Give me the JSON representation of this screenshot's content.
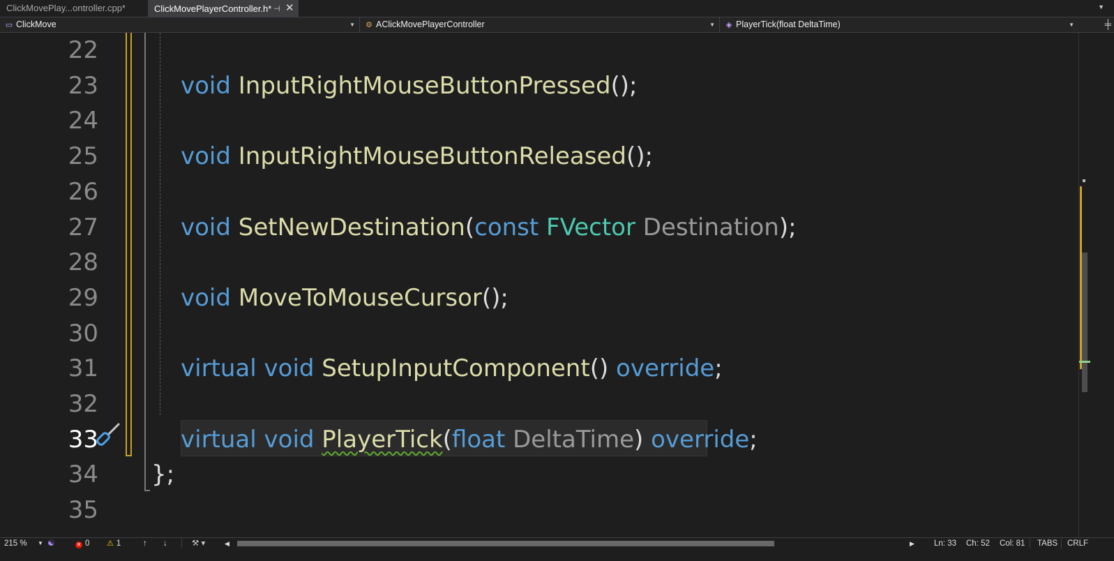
{
  "tabs": [
    {
      "label": "ClickMovePlay...ontroller.cpp*",
      "active": false
    },
    {
      "label": "ClickMovePlayerController.h*",
      "active": true,
      "pin_icon": "pin-icon",
      "close_icon": "close-icon"
    }
  ],
  "navbar": {
    "project": "ClickMove",
    "class_scope": "AClickMovePlayerController",
    "member": "PlayerTick(float DeltaTime)"
  },
  "editor": {
    "current_line": 33,
    "lines": [
      {
        "number": "22",
        "tokens": []
      },
      {
        "number": "23",
        "tokens": [
          {
            "t": "void",
            "c": "kw"
          },
          {
            "t": " "
          },
          {
            "t": "InputRightMouseButtonPressed",
            "c": "fn"
          },
          {
            "t": "();",
            "c": "pn"
          }
        ]
      },
      {
        "number": "24",
        "tokens": []
      },
      {
        "number": "25",
        "tokens": [
          {
            "t": "void",
            "c": "kw"
          },
          {
            "t": " "
          },
          {
            "t": "InputRightMouseButtonReleased",
            "c": "fn"
          },
          {
            "t": "();",
            "c": "pn"
          }
        ]
      },
      {
        "number": "26",
        "tokens": []
      },
      {
        "number": "27",
        "tokens": [
          {
            "t": "void",
            "c": "kw"
          },
          {
            "t": " "
          },
          {
            "t": "SetNewDestination",
            "c": "fn"
          },
          {
            "t": "(",
            "c": "pn"
          },
          {
            "t": "const",
            "c": "kw"
          },
          {
            "t": " "
          },
          {
            "t": "FVector",
            "c": "tp"
          },
          {
            "t": " "
          },
          {
            "t": "Destination",
            "c": "pm"
          },
          {
            "t": ");",
            "c": "pn"
          }
        ]
      },
      {
        "number": "28",
        "tokens": []
      },
      {
        "number": "29",
        "tokens": [
          {
            "t": "void",
            "c": "kw"
          },
          {
            "t": " "
          },
          {
            "t": "MoveToMouseCursor",
            "c": "fn"
          },
          {
            "t": "();",
            "c": "pn"
          }
        ]
      },
      {
        "number": "30",
        "tokens": []
      },
      {
        "number": "31",
        "tokens": [
          {
            "t": "virtual",
            "c": "kw"
          },
          {
            "t": " "
          },
          {
            "t": "void",
            "c": "kw"
          },
          {
            "t": " "
          },
          {
            "t": "SetupInputComponent",
            "c": "fn"
          },
          {
            "t": "() ",
            "c": "pn"
          },
          {
            "t": "override",
            "c": "kw"
          },
          {
            "t": ";",
            "c": "pn"
          }
        ]
      },
      {
        "number": "32",
        "tokens": []
      },
      {
        "number": "33",
        "tokens": [
          {
            "t": "virtual",
            "c": "kw"
          },
          {
            "t": " "
          },
          {
            "t": "void",
            "c": "kw"
          },
          {
            "t": " "
          },
          {
            "t": "PlayerTick",
            "c": "fn",
            "squiggle": true
          },
          {
            "t": "(",
            "c": "pn"
          },
          {
            "t": "float",
            "c": "kw"
          },
          {
            "t": " "
          },
          {
            "t": "DeltaTime",
            "c": "pm"
          },
          {
            "t": ") ",
            "c": "pn"
          },
          {
            "t": "override",
            "c": "kw"
          },
          {
            "t": ";",
            "c": "pn"
          }
        ]
      },
      {
        "number": "34",
        "brace": true,
        "tokens": [
          {
            "t": "};",
            "c": "pn"
          }
        ]
      },
      {
        "number": "35",
        "tokens": []
      }
    ]
  },
  "status": {
    "zoom": "215 %",
    "errors": "0",
    "warnings": "1",
    "line": "Ln: 33",
    "char": "Ch: 52",
    "col": "Col: 81",
    "indent": "TABS",
    "eol": "CRLF"
  },
  "colors": {
    "keyword": "#569cd6",
    "function": "#dcdcaa",
    "type": "#4ec9b0",
    "parameter": "#9a9a9a",
    "change_bar": "#c9a227",
    "squiggle": "#5faa2f"
  }
}
